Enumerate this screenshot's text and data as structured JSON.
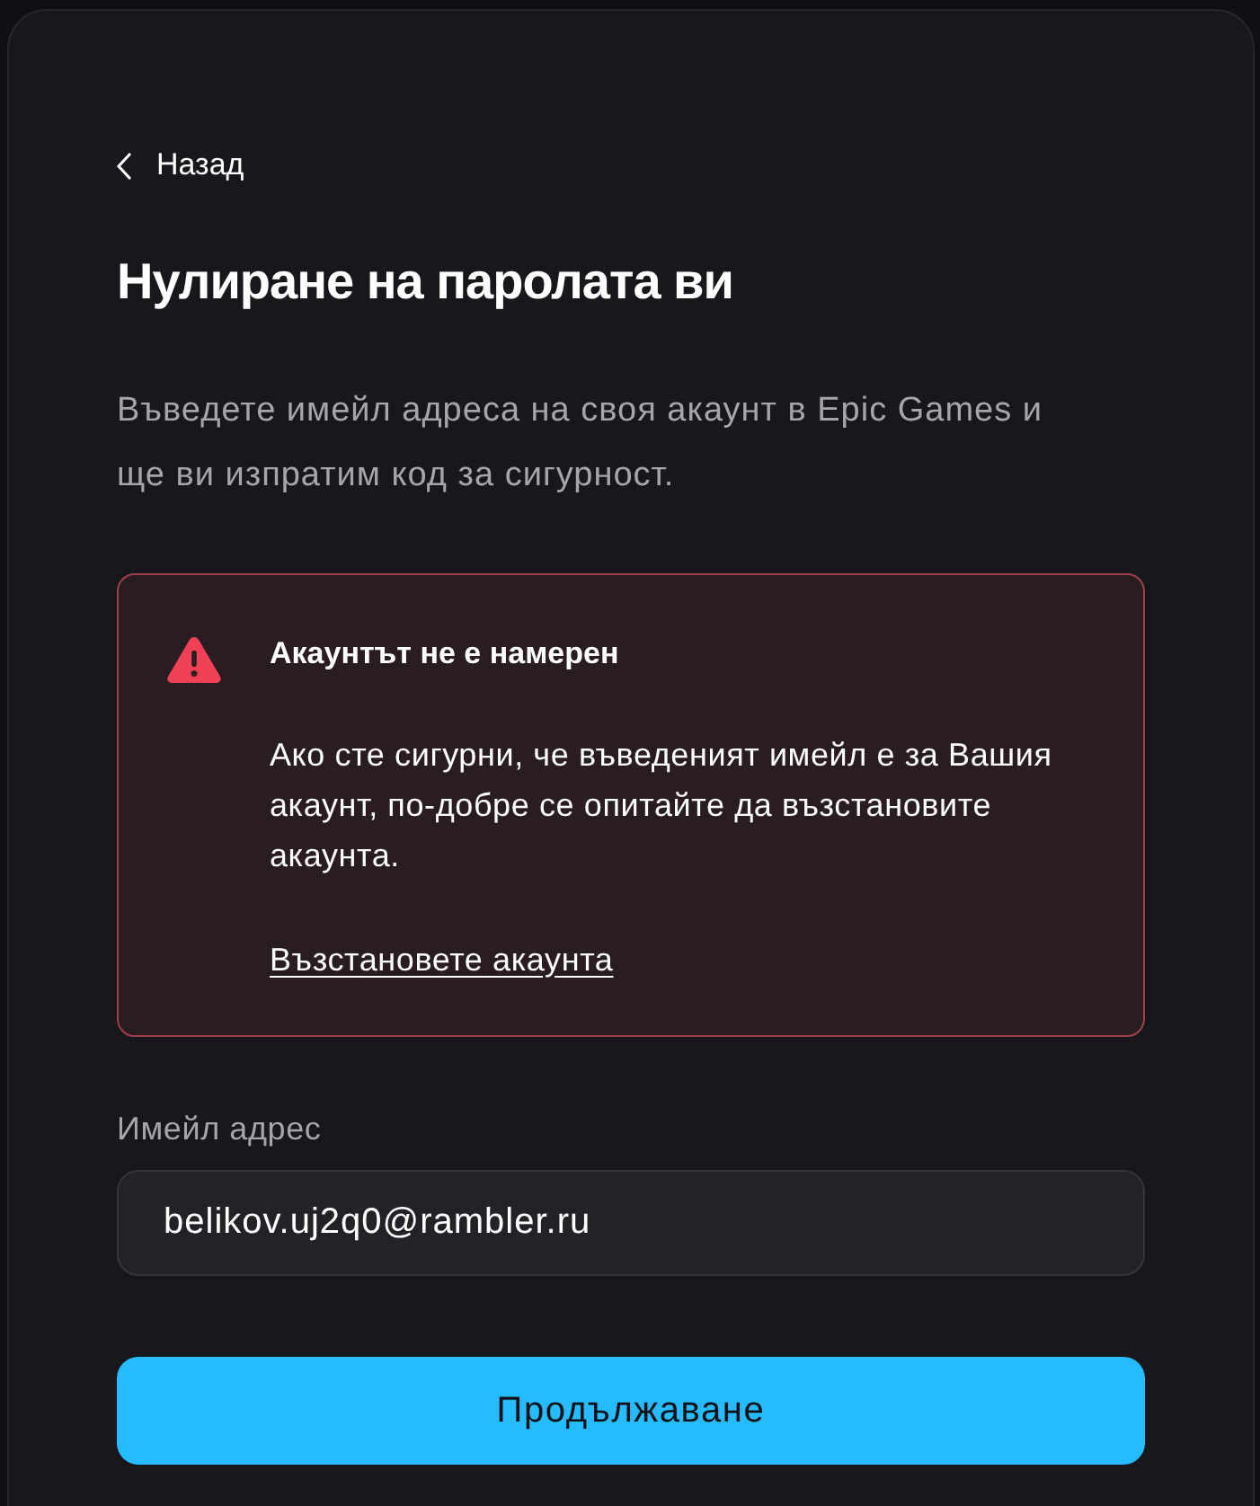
{
  "back_link": {
    "label": "Назад"
  },
  "title": "Нулиране на паролата ви",
  "description": "Въведете имейл адреса на своя акаунт в Epic Games и ще ви изпратим код за сигурност.",
  "alert": {
    "kind": "error",
    "title": "Акаунтът не е намерен",
    "message": "Ако сте сигурни, че въведеният имейл е за Вашия акаунт, по-добре се опитайте да възстановите акаунта.",
    "link": "Възстановете акаунта"
  },
  "email_field": {
    "label": "Имейл адрес",
    "value": "belikov.uj2q0@rambler.ru"
  },
  "submit_button": {
    "label": "Продължаване"
  }
}
